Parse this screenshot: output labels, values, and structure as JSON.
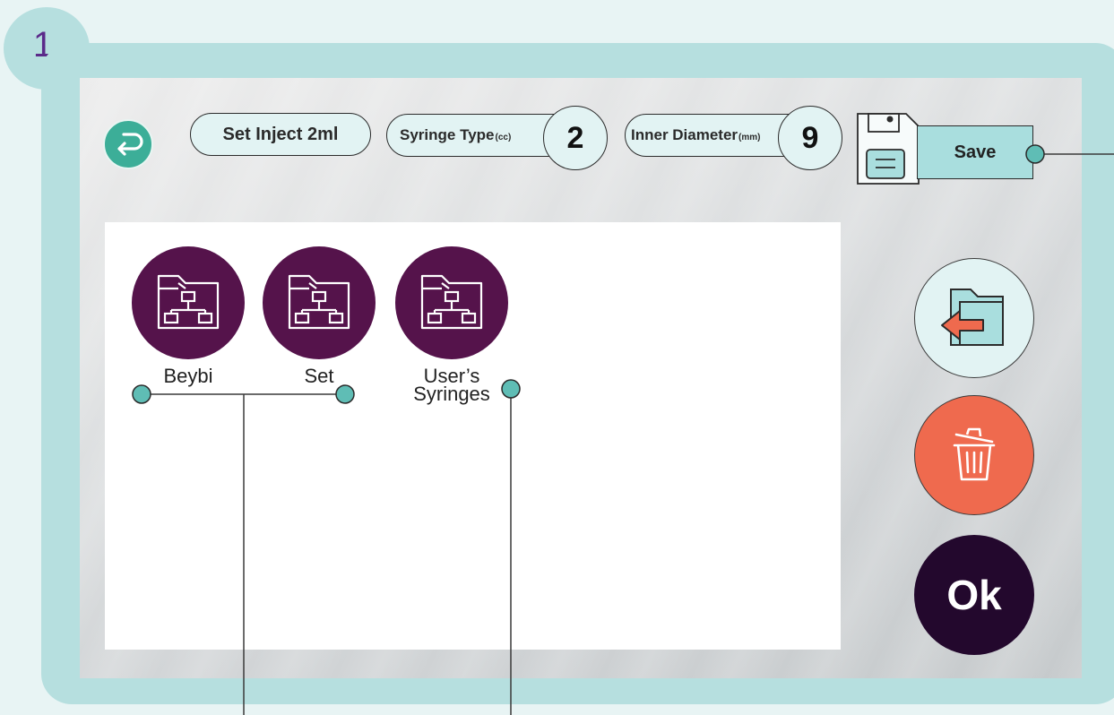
{
  "step_number": "1",
  "header": {
    "program_label": "Set Inject 2ml",
    "syringe_type_label": "Syringe Type",
    "syringe_type_unit": "(cc)",
    "syringe_type_value": "2",
    "inner_diameter_label": "Inner Diameter",
    "inner_diameter_unit": "(mm)",
    "inner_diameter_value": "9",
    "save_label": "Save"
  },
  "folders": [
    {
      "label": "Beybi",
      "icon": "folder-network-icon"
    },
    {
      "label": "Set",
      "icon": "folder-network-icon"
    },
    {
      "label": "User’s\nSyringes",
      "icon": "folder-network-icon"
    }
  ],
  "side_buttons": {
    "load_icon": "folder-load-icon",
    "delete_icon": "trash-icon",
    "ok_label": "Ok"
  },
  "colors": {
    "frame": "#b6dfdf",
    "back_button": "#3cae98",
    "folder": "#55134b",
    "delete": "#ef6a4e",
    "ok": "#23082d",
    "callout": "#5fbdb5"
  }
}
